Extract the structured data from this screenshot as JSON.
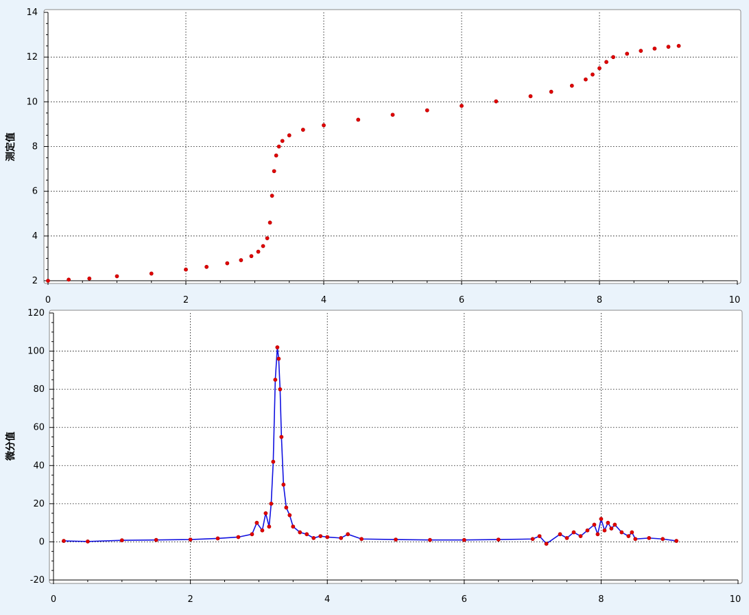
{
  "chart_data": [
    {
      "type": "scatter",
      "ylabel": "测定值",
      "xlim": [
        0,
        10
      ],
      "ylim": [
        2,
        14
      ],
      "xticks": [
        0,
        2,
        4,
        6,
        8,
        10
      ],
      "yticks": [
        2,
        4,
        6,
        8,
        10,
        12,
        14
      ],
      "grid": true,
      "series": [
        {
          "color": "#e00000",
          "marker": "circle",
          "x": [
            0.0,
            0.3,
            0.6,
            1.0,
            1.5,
            2.0,
            2.3,
            2.6,
            2.8,
            2.95,
            3.05,
            3.12,
            3.18,
            3.22,
            3.25,
            3.28,
            3.31,
            3.35,
            3.4,
            3.5,
            3.7,
            4.0,
            4.5,
            5.0,
            5.5,
            6.0,
            6.5,
            7.0,
            7.3,
            7.6,
            7.8,
            7.9,
            8.0,
            8.1,
            8.2,
            8.4,
            8.6,
            8.8,
            9.0,
            9.15
          ],
          "y": [
            2.0,
            2.05,
            2.1,
            2.2,
            2.32,
            2.5,
            2.62,
            2.78,
            2.92,
            3.1,
            3.3,
            3.55,
            3.9,
            4.6,
            5.8,
            6.9,
            7.6,
            8.0,
            8.25,
            8.5,
            8.75,
            8.95,
            9.2,
            9.42,
            9.62,
            9.82,
            10.02,
            10.25,
            10.45,
            10.72,
            11.0,
            11.22,
            11.5,
            11.78,
            12.0,
            12.15,
            12.28,
            12.38,
            12.46,
            12.5
          ]
        }
      ]
    },
    {
      "type": "line",
      "ylabel": "微分值",
      "xlim": [
        0,
        10
      ],
      "ylim": [
        -20,
        120
      ],
      "xticks": [
        0,
        2,
        4,
        6,
        8,
        10
      ],
      "yticks": [
        -20,
        0,
        20,
        40,
        60,
        80,
        100,
        120
      ],
      "grid": true,
      "series": [
        {
          "color": "#1010e0",
          "marker_color": "#e00000",
          "marker": "circle",
          "x": [
            0.15,
            0.5,
            1.0,
            1.5,
            2.0,
            2.4,
            2.7,
            2.9,
            2.97,
            3.05,
            3.1,
            3.15,
            3.18,
            3.21,
            3.24,
            3.27,
            3.29,
            3.31,
            3.33,
            3.36,
            3.4,
            3.45,
            3.5,
            3.6,
            3.7,
            3.8,
            3.9,
            4.0,
            4.2,
            4.3,
            4.5,
            5.0,
            5.5,
            6.0,
            6.5,
            7.0,
            7.1,
            7.2,
            7.4,
            7.5,
            7.6,
            7.7,
            7.8,
            7.9,
            7.95,
            8.0,
            8.05,
            8.1,
            8.15,
            8.2,
            8.3,
            8.4,
            8.45,
            8.5,
            8.7,
            8.9,
            9.1
          ],
          "y": [
            0.5,
            0.2,
            0.8,
            1.0,
            1.2,
            1.8,
            2.5,
            4.0,
            10.0,
            6.0,
            15.0,
            8.0,
            20.0,
            42.0,
            85.0,
            102.0,
            96.0,
            80.0,
            55.0,
            30.0,
            18.0,
            14.0,
            8.0,
            5.0,
            4.0,
            2.0,
            3.0,
            2.5,
            2.0,
            4.0,
            1.5,
            1.2,
            1.0,
            1.0,
            1.2,
            1.5,
            3.0,
            -1.0,
            4.0,
            2.0,
            5.0,
            3.0,
            6.0,
            9.0,
            4.0,
            12.0,
            6.0,
            10.0,
            7.0,
            9.0,
            5.0,
            3.0,
            5.0,
            1.5,
            2.0,
            1.5,
            0.5
          ]
        }
      ]
    }
  ]
}
